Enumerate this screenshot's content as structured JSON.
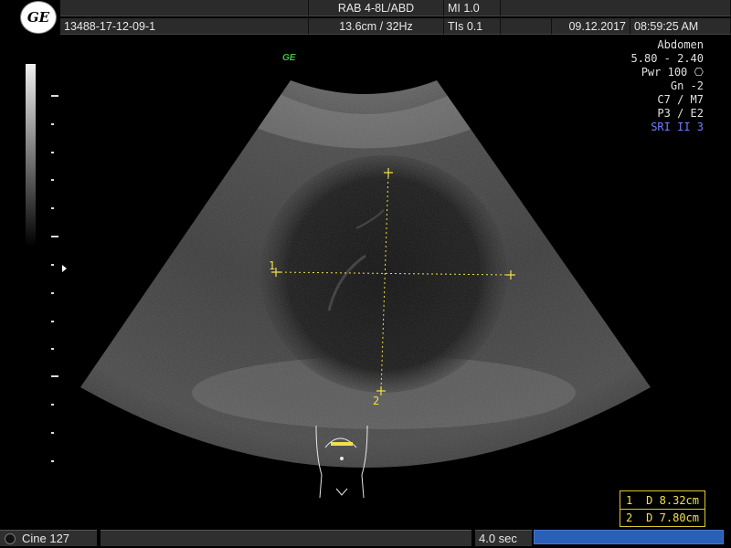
{
  "header": {
    "logo": "GE",
    "probe": "RAB 4-8L/ABD",
    "mi": "MI  1.0",
    "patient_id": "13488-17-12-09-1",
    "depth_freq": "13.6cm / 32Hz",
    "tis": "TIs  0.1",
    "date": "09.12.2017",
    "time": "08:59:25 AM"
  },
  "info": {
    "preset": "Abdomen",
    "freq": "5.80 - 2.40",
    "power": "Pwr 100",
    "gain": "Gn  -2",
    "cm": "C7 / M7",
    "pe": "P3 / E2",
    "sri": "SRI II 3"
  },
  "watermark": "GE",
  "markers": {
    "m1": "1",
    "m2": "2"
  },
  "measurements": [
    {
      "idx": "1",
      "label": "D",
      "value": "8.32cm"
    },
    {
      "idx": "2",
      "label": "D",
      "value": "7.80cm"
    }
  ],
  "footer": {
    "cine": "Cine 127",
    "duration": "4.0 sec"
  },
  "colors": {
    "caliper": "#f2e04a",
    "sri": "#6f7dff",
    "progress": "#2a5fb8"
  }
}
